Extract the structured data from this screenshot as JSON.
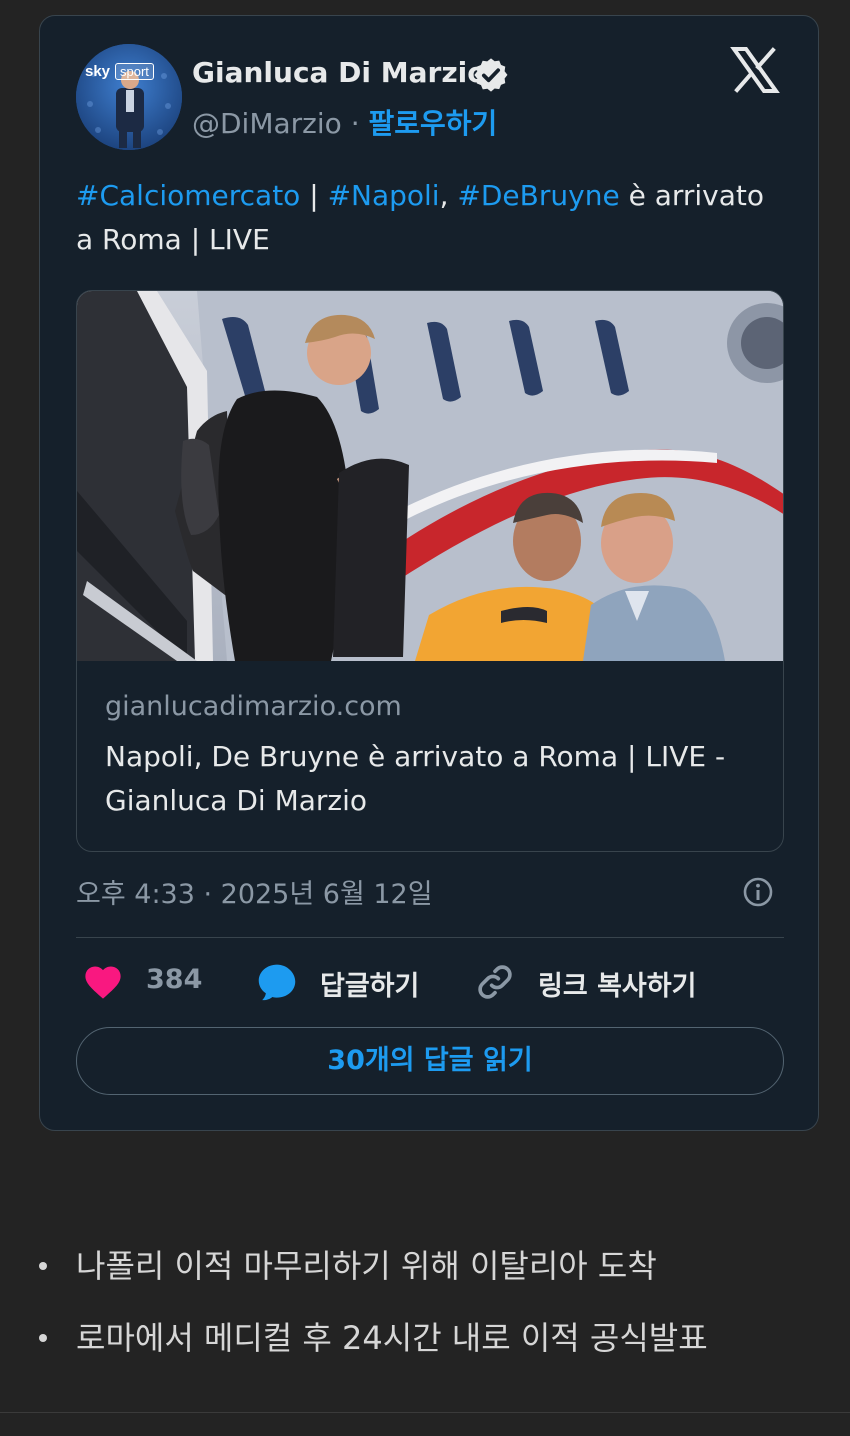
{
  "tweet": {
    "author": {
      "name": "Gianluca Di Marzio",
      "handle": "@DiMarzio",
      "separator": "·",
      "follow_label": "팔로우하기",
      "avatar_brand_text": "sky sport"
    },
    "text": {
      "hashtag_1": "#Calciomercato",
      "sep_1": " | ",
      "hashtag_2": "#Napoli",
      "sep_2": ", ",
      "hashtag_3": "#DeBruyne",
      "rest": " è arrivato a Roma | LIVE"
    },
    "link_card": {
      "domain": "gianlucadimarzio.com",
      "title": "Napoli, De Bruyne è arrivato a Roma | LIVE - Gianluca Di Marzio"
    },
    "timestamp": "오후 4:33 · 2025년 6월 12일",
    "actions": {
      "like_count": "384",
      "reply_label": "답글하기",
      "copy_link_label": "링크 복사하기"
    },
    "read_replies_label": "30개의 답글 읽기"
  },
  "bullets": [
    "나폴리 이적 마무리하기 위해 이탈리아 도착",
    "로마에서 메디컬 후 24시간 내로 이적 공식발표"
  ],
  "colors": {
    "accent": "#1d9bf0",
    "like": "#f91880",
    "card_bg": "#15202b",
    "page_bg": "#232323"
  }
}
